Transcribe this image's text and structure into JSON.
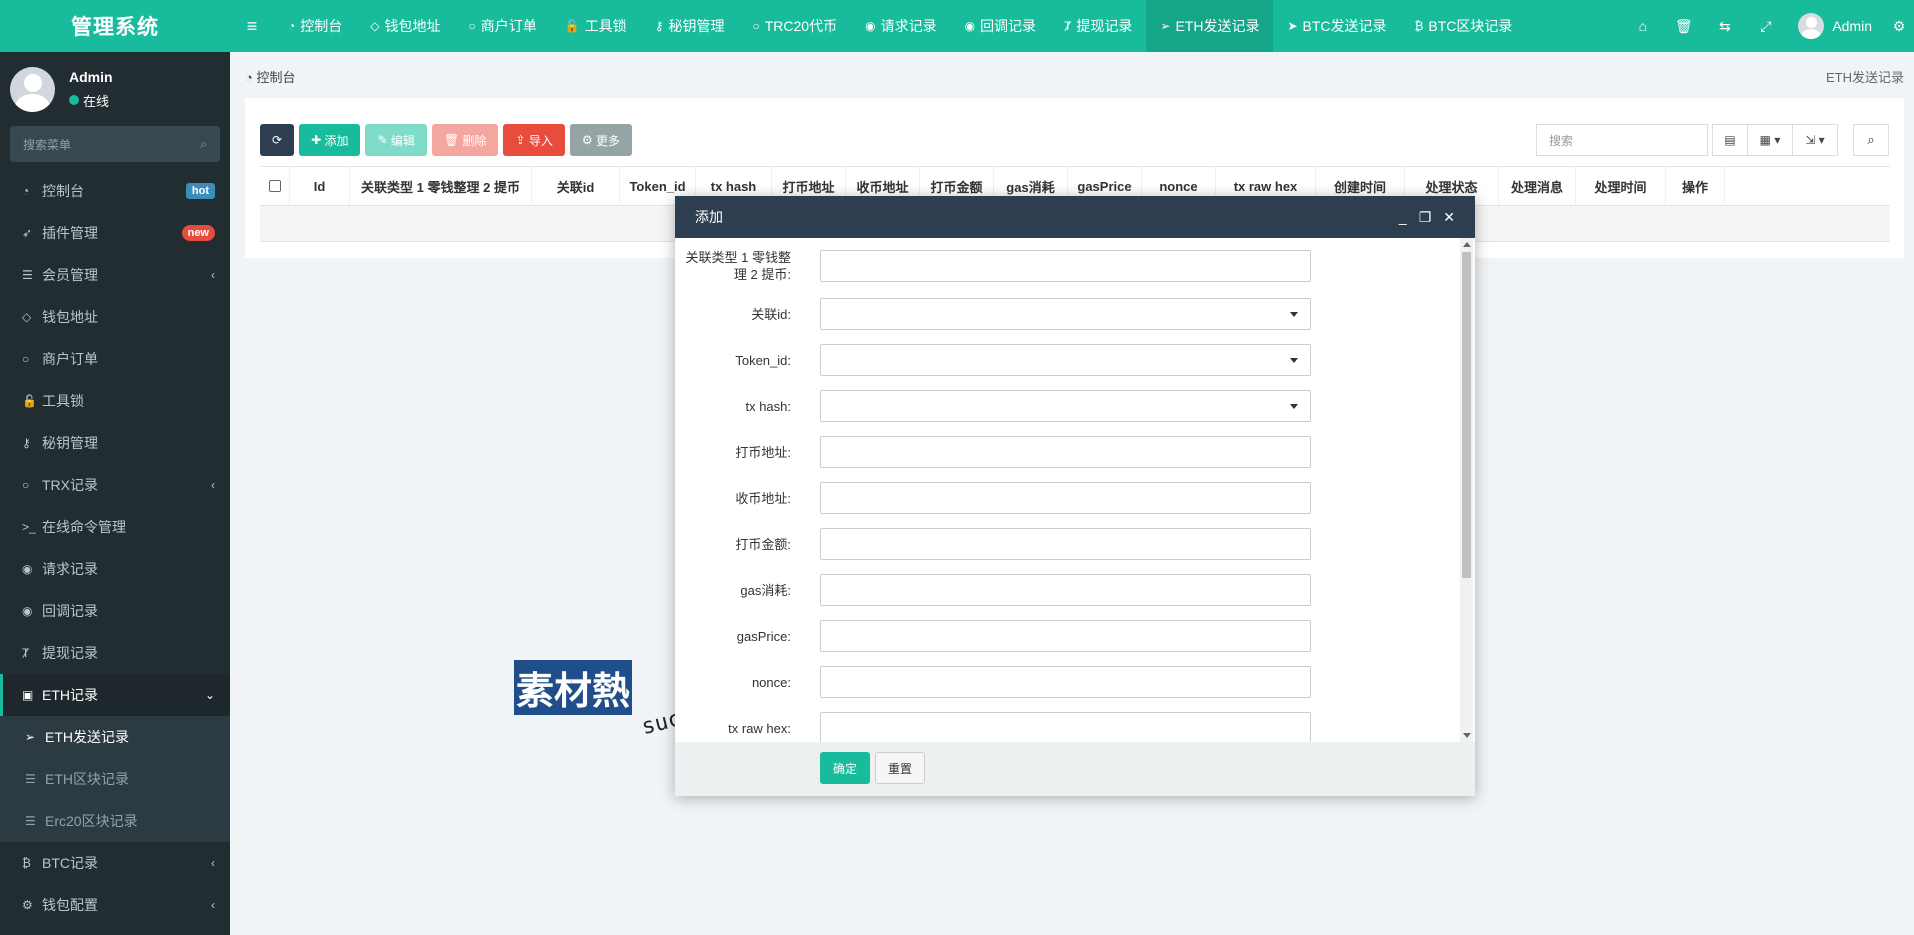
{
  "app": {
    "title": "管理系统"
  },
  "topnav": {
    "items": [
      {
        "icon": "dashboard-icon",
        "glyph": "◔",
        "label": "控制台"
      },
      {
        "icon": "diamond-icon",
        "glyph": "◇",
        "label": "钱包地址"
      },
      {
        "icon": "circle-icon",
        "glyph": "○",
        "label": "商户订单"
      },
      {
        "icon": "lock-icon",
        "glyph": "🔓",
        "label": "工具锁"
      },
      {
        "icon": "key-icon",
        "glyph": "⚷",
        "label": "秘钥管理"
      },
      {
        "icon": "circle-icon",
        "glyph": "○",
        "label": "TRC20代币"
      },
      {
        "icon": "arrow-circle-icon",
        "glyph": "◉",
        "label": "请求记录"
      },
      {
        "icon": "arrow-circle-icon",
        "glyph": "◉",
        "label": "回调记录"
      },
      {
        "icon": "text-icon",
        "glyph": "Ⱦ",
        "label": "提现记录"
      },
      {
        "icon": "send-icon",
        "glyph": "➢",
        "label": "ETH发送记录",
        "active": true
      },
      {
        "icon": "send-icon",
        "glyph": "➤",
        "label": "BTC发送记录"
      },
      {
        "icon": "bitcoin-icon",
        "glyph": "₿",
        "label": "BTC区块记录"
      }
    ],
    "user": "Admin"
  },
  "sidebar": {
    "profile": {
      "name": "Admin",
      "status": "在线"
    },
    "search_placeholder": "搜索菜单",
    "items": [
      {
        "icon": "dashboard-icon",
        "glyph": "◔",
        "label": "控制台",
        "badge": "hot"
      },
      {
        "icon": "rocket-icon",
        "glyph": "➶",
        "label": "插件管理",
        "badge": "new"
      },
      {
        "icon": "list-icon",
        "glyph": "☰",
        "label": "会员管理",
        "arrow": "‹"
      },
      {
        "icon": "diamond-icon",
        "glyph": "◇",
        "label": "钱包地址"
      },
      {
        "icon": "circle-icon",
        "glyph": "○",
        "label": "商户订单"
      },
      {
        "icon": "lock-icon",
        "glyph": "🔓",
        "label": "工具锁"
      },
      {
        "icon": "key-icon",
        "glyph": "⚷",
        "label": "秘钥管理"
      },
      {
        "icon": "circle-icon",
        "glyph": "○",
        "label": "TRX记录",
        "arrow": "‹"
      },
      {
        "icon": "terminal-icon",
        "glyph": ">_",
        "label": "在线命令管理"
      },
      {
        "icon": "arrow-circle-icon",
        "glyph": "◉",
        "label": "请求记录"
      },
      {
        "icon": "arrow-circle-icon",
        "glyph": "◉",
        "label": "回调记录"
      },
      {
        "icon": "text-icon",
        "glyph": "Ⱦ",
        "label": "提现记录"
      }
    ],
    "open_item": {
      "icon": "hdd-icon",
      "glyph": "▣",
      "label": "ETH记录",
      "arrow": "⌄"
    },
    "sub_items": [
      {
        "icon": "send-icon",
        "glyph": "➢",
        "label": "ETH发送记录",
        "active": true
      },
      {
        "icon": "list-icon",
        "glyph": "☰",
        "label": "ETH区块记录"
      },
      {
        "icon": "list-icon",
        "glyph": "☰",
        "label": "Erc20区块记录"
      }
    ],
    "after_items": [
      {
        "icon": "bitcoin-icon",
        "glyph": "₿",
        "label": "BTC记录",
        "arrow": "‹"
      },
      {
        "icon": "gear-icon",
        "glyph": "⚙",
        "label": "钱包配置",
        "arrow": "‹"
      }
    ]
  },
  "breadcrumb": {
    "label": "控制台",
    "right": "ETH发送记录"
  },
  "toolbar": {
    "add": "添加",
    "edit": "编辑",
    "delete": "删除",
    "import": "导入",
    "more": "更多",
    "search_placeholder": "搜索"
  },
  "table": {
    "columns": [
      "Id",
      "关联类型 1 零钱整理 2 提币",
      "关联id",
      "Token_id",
      "tx hash",
      "打币地址",
      "收币地址",
      "打币金额",
      "gas消耗",
      "gasPrice",
      "nonce",
      "tx raw hex",
      "创建时间",
      "处理状态",
      "处理消息",
      "处理时间",
      "操作"
    ]
  },
  "modal": {
    "title": "添加",
    "fields": [
      {
        "label": "关联类型 1 零钱整理 2 提币:",
        "type": "text"
      },
      {
        "label": "关联id:",
        "type": "select"
      },
      {
        "label": "Token_id:",
        "type": "select"
      },
      {
        "label": "tx hash:",
        "type": "select"
      },
      {
        "label": "打币地址:",
        "type": "text"
      },
      {
        "label": "收币地址:",
        "type": "text"
      },
      {
        "label": "打币金额:",
        "type": "text"
      },
      {
        "label": "gas消耗:",
        "type": "text"
      },
      {
        "label": "gasPrice:",
        "type": "text"
      },
      {
        "label": "nonce:",
        "type": "text"
      },
      {
        "label": "tx raw hex:",
        "type": "text"
      }
    ],
    "ok": "确定",
    "reset": "重置"
  },
  "watermark": {
    "brand": "素材熱",
    "url": "sucaire.com"
  }
}
